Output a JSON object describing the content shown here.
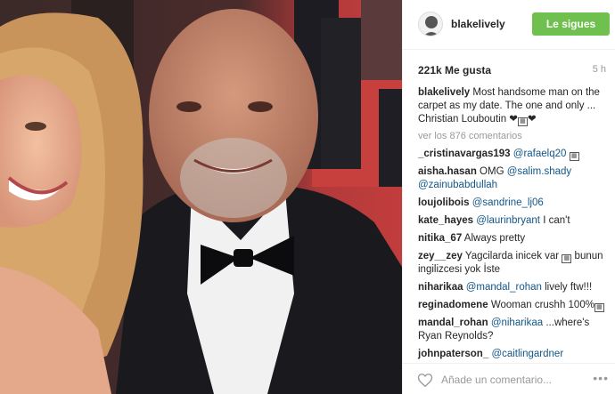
{
  "post": {
    "username": "blakelively",
    "follow_label": "Le sigues",
    "likes": "221k Me gusta",
    "time": "5 h",
    "caption": {
      "user": "blakelively",
      "text": "Most handsome man on the carpet as my date. The one and only ... Christian Louboutin ❤"
    },
    "view_all": "ver los 876 comentarios",
    "comments": [
      {
        "user": "_cristinavargas193",
        "mention": "@rafaelq20",
        "text": ""
      },
      {
        "user": "aisha.hasan",
        "pre": "OMG",
        "mention": "@salim.shady @zainubabdullah",
        "text": ""
      },
      {
        "user": "loujolibois",
        "mention": "@sandrine_lj06",
        "text": ""
      },
      {
        "user": "kate_hayes",
        "mention": "@laurinbryant",
        "text": "I can't"
      },
      {
        "user": "nitika_67",
        "text": "Always pretty"
      },
      {
        "user": "zey__zey",
        "text": "Yagcilarda inicek var",
        "text2": "bunun ingilizcesi yok İste"
      },
      {
        "user": "niharikaa",
        "mention": "@mandal_rohan",
        "text": "lively ftw!!!"
      },
      {
        "user": "reginadomene",
        "text": "Wooman crushh 100%"
      },
      {
        "user": "mandal_rohan",
        "mention": "@niharikaa",
        "text": "...where's Ryan Reynolds?"
      },
      {
        "user": "johnpaterson_",
        "mention": "@caitlingardner",
        "text": ""
      }
    ],
    "comment_placeholder": "Añade un comentario...",
    "more_icon": "•••"
  },
  "colors": {
    "follow_green": "#70c050",
    "mention_blue": "#125688",
    "muted_gray": "#999999"
  },
  "icons": [
    "heart-icon",
    "more-options-icon",
    "avatar"
  ]
}
